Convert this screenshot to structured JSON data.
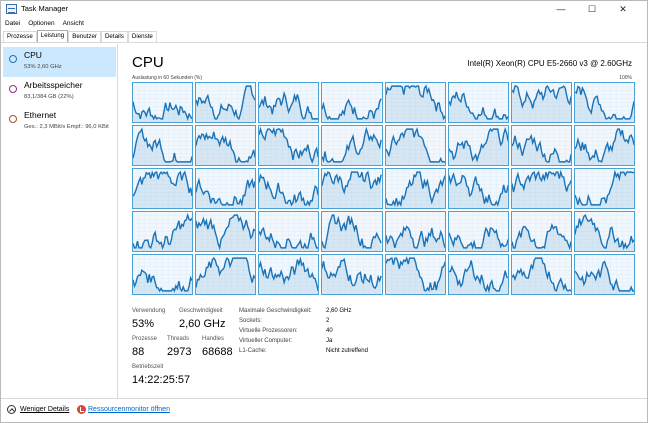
{
  "window": {
    "title": "Task Manager",
    "controls": {
      "minimize": "—",
      "maximize": "☐",
      "close": "✕"
    }
  },
  "menu": [
    "Datei",
    "Optionen",
    "Ansicht"
  ],
  "tabs": [
    {
      "label": "Prozesse",
      "active": false
    },
    {
      "label": "Leistung",
      "active": true
    },
    {
      "label": "Benutzer",
      "active": false
    },
    {
      "label": "Details",
      "active": false
    },
    {
      "label": "Dienste",
      "active": false
    }
  ],
  "sidebar": {
    "items": [
      {
        "title": "CPU",
        "subtitle": "53% 2,60 GHz",
        "selected": true,
        "color": "#1a73b8"
      },
      {
        "title": "Arbeitsspeicher",
        "subtitle": "83,1/384 GB (22%)",
        "selected": false,
        "color": "#8b2f8f"
      },
      {
        "title": "Ethernet",
        "subtitle": "Ges.: 2,3 MBit/s Empf.: 96,0 KBit",
        "selected": false,
        "color": "#a0522d"
      }
    ]
  },
  "main": {
    "title": "CPU",
    "model": "Intel(R) Xeon(R) CPU E5-2660 v3 @ 2.60GHz",
    "graph_caption": "Auslastung in 60 Sekunden (%)",
    "graph_max": "100%",
    "graph_color": "#1a73b8",
    "graph_count": 40
  },
  "stats": {
    "verwendung": {
      "label": "Verwendung",
      "value": "53%"
    },
    "geschwindigkeit": {
      "label": "Geschwindigkeit",
      "value": "2,60 GHz"
    },
    "prozesse": {
      "label": "Prozesse",
      "value": "88"
    },
    "threads": {
      "label": "Threads",
      "value": "2973"
    },
    "handles": {
      "label": "Handles",
      "value": "68688"
    },
    "betriebszeit": {
      "label": "Betriebszeit",
      "value": "14:22:25:57"
    }
  },
  "info": [
    {
      "label": "Maximale Geschwindigkeit:",
      "value": "2,60 GHz"
    },
    {
      "label": "Sockets:",
      "value": "2"
    },
    {
      "label": "Virtuelle Prozessoren:",
      "value": "40"
    },
    {
      "label": "Virtueller Computer:",
      "value": "Ja"
    },
    {
      "label": "L1-Cache:",
      "value": "Nicht zutreffend"
    }
  ],
  "footer": {
    "fewer_details": "Weniger Details",
    "resource_monitor": "Ressourcenmonitor öffnen"
  }
}
